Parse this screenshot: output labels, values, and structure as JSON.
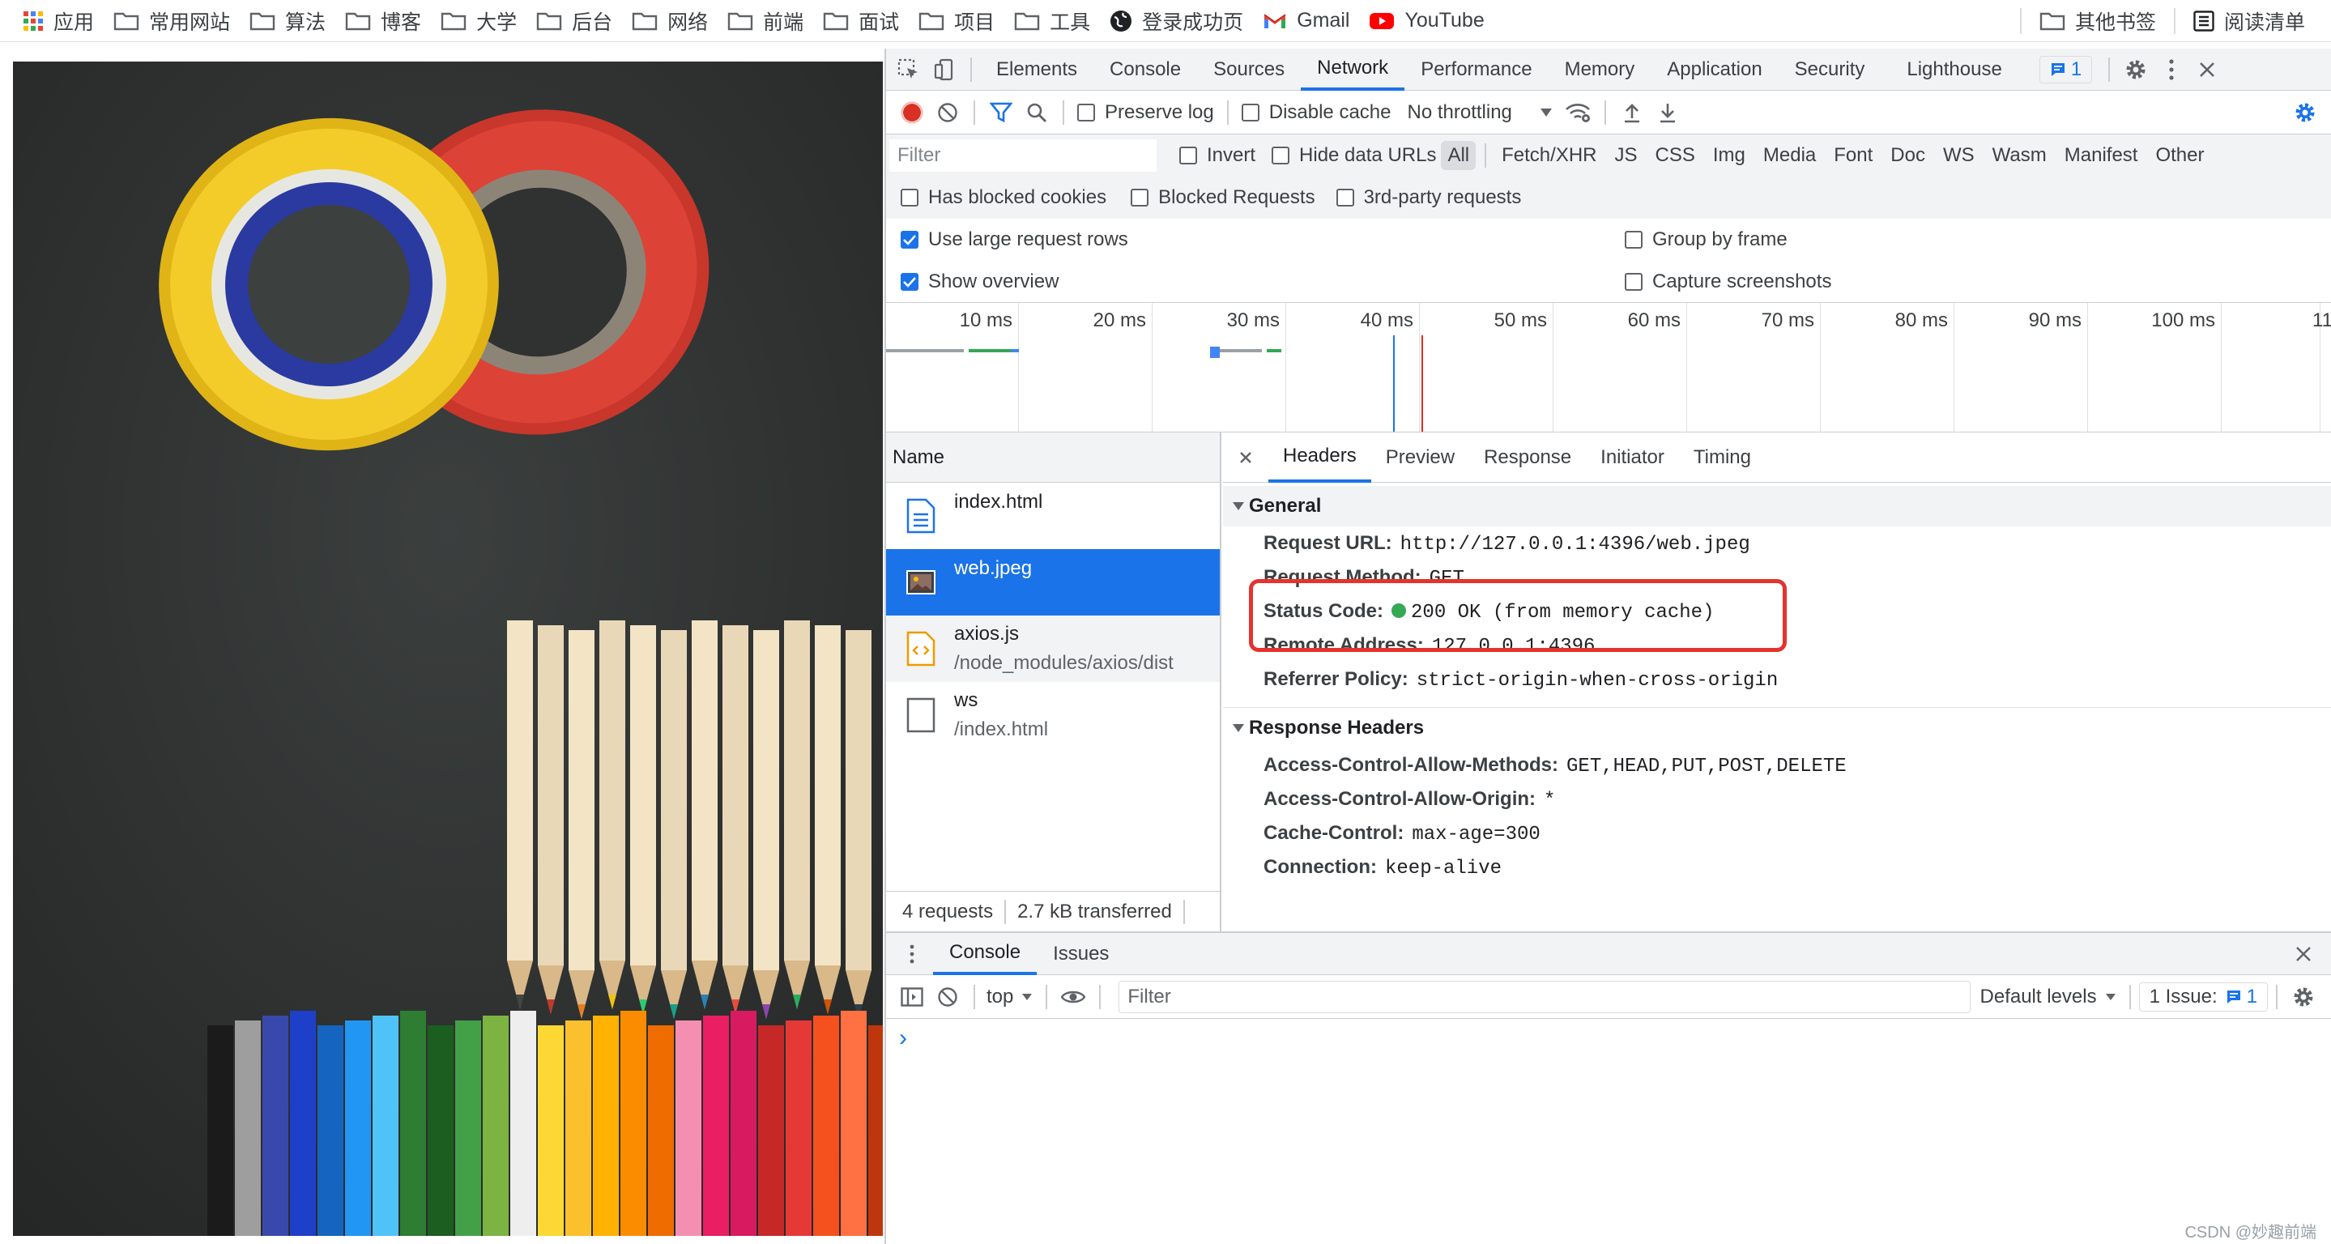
{
  "bookmarks": {
    "items": [
      "应用",
      "常用网站",
      "算法",
      "博客",
      "大学",
      "后台",
      "网络",
      "前端",
      "面试",
      "项目",
      "工具",
      "登录成功页",
      "Gmail",
      "YouTube"
    ],
    "right": [
      "其他书签",
      "阅读清单"
    ]
  },
  "devtools": {
    "tabs": [
      "Elements",
      "Console",
      "Sources",
      "Network",
      "Performance",
      "Memory",
      "Application",
      "Security",
      "Lighthouse"
    ],
    "active_tab": "Network",
    "issues_badge": "1",
    "toolbar": {
      "preserve_log": "Preserve log",
      "disable_cache": "Disable cache",
      "throttling": "No throttling"
    },
    "filter": {
      "placeholder": "Filter",
      "invert": "Invert",
      "hide_data_urls": "Hide data URLs",
      "types": [
        "All",
        "Fetch/XHR",
        "JS",
        "CSS",
        "Img",
        "Media",
        "Font",
        "Doc",
        "WS",
        "Wasm",
        "Manifest",
        "Other"
      ],
      "active_type": "All",
      "has_blocked_cookies": "Has blocked cookies",
      "blocked_requests": "Blocked Requests",
      "third_party": "3rd-party requests"
    },
    "settings": {
      "large_rows": "Use large request rows",
      "show_overview": "Show overview",
      "group_by_frame": "Group by frame",
      "capture_screenshots": "Capture screenshots"
    },
    "overview_ticks": [
      "10 ms",
      "20 ms",
      "30 ms",
      "40 ms",
      "50 ms",
      "60 ms",
      "70 ms",
      "80 ms",
      "90 ms",
      "100 ms",
      "110 ms"
    ],
    "request_list": {
      "header": "Name",
      "requests": [
        {
          "name": "index.html",
          "path": ""
        },
        {
          "name": "web.jpeg",
          "path": ""
        },
        {
          "name": "axios.js",
          "path": "/node_modules/axios/dist"
        },
        {
          "name": "ws",
          "path": "/index.html"
        }
      ],
      "status": {
        "requests": "4 requests",
        "transferred": "2.7 kB transferred"
      }
    },
    "details": {
      "tabs": [
        "Headers",
        "Preview",
        "Response",
        "Initiator",
        "Timing"
      ],
      "general_title": "General",
      "general": [
        {
          "key": "Request URL:",
          "value": "http://127.0.0.1:4396/web.jpeg"
        },
        {
          "key": "Request Method:",
          "value": "GET"
        },
        {
          "key": "Status Code:",
          "value": "200 OK (from memory cache)"
        },
        {
          "key": "Remote Address:",
          "value": "127.0.0.1:4396"
        },
        {
          "key": "Referrer Policy:",
          "value": "strict-origin-when-cross-origin"
        }
      ],
      "response_title": "Response Headers",
      "response": [
        {
          "key": "Access-Control-Allow-Methods:",
          "value": "GET,HEAD,PUT,POST,DELETE"
        },
        {
          "key": "Access-Control-Allow-Origin:",
          "value": "*"
        },
        {
          "key": "Cache-Control:",
          "value": "max-age=300"
        },
        {
          "key": "Connection:",
          "value": "keep-alive"
        }
      ]
    },
    "drawer": {
      "tabs": [
        "Console",
        "Issues"
      ],
      "context": "top",
      "filter_placeholder": "Filter",
      "levels": "Default levels",
      "issues": "1 Issue:",
      "issues_count": "1",
      "prompt": "›"
    }
  },
  "watermark": "CSDN @妙趣前端"
}
